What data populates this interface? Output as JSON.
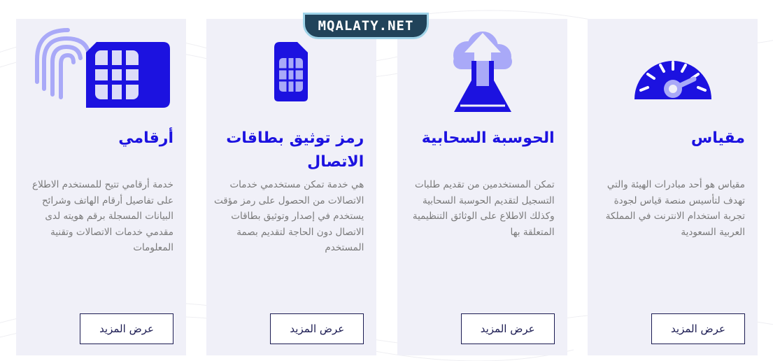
{
  "site": {
    "logo_text": "MQALATY.NET"
  },
  "cards": [
    {
      "title": "مقياس",
      "description": "مقياس هو أحد مبادرات الهيئة والتي تهدف لتأسيس منصة قياس لجودة تجربة استخدام الانترنت في المملكة العربية السعودية",
      "button_label": "عرض المزيد",
      "icon": "speedometer-icon"
    },
    {
      "title": "الحوسبة السحابية",
      "description": "تمكن المستخدمين من تقديم طلبات التسجيل لتقديم الحوسبة السحابية وكذلك الاطلاع على الوثائق التنظيمية المتعلقة بها",
      "button_label": "عرض المزيد",
      "icon": "cloud-upload-icon"
    },
    {
      "title": "رمز توثيق بطاقات الاتصال",
      "description": "هي خدمة تمكن مستخدمي خدمات الاتصالات من الحصول على رمز مؤقت يستخدم في إصدار وتوثيق بطاقات الاتصال دون الحاجة لتقديم بصمة المستخدم",
      "button_label": "عرض المزيد",
      "icon": "sim-card-icon"
    },
    {
      "title": "أرقامي",
      "description": "خدمة أرقامي تتيح للمستخدم الاطلاع على تفاصيل أرقام الهاتف وشرائح البيانات المسجلة برقم هويته لدى مقدمي خدمات الاتصالات وتقنية المعلومات",
      "button_label": "عرض المزيد",
      "icon": "fingerprint-sim-icon"
    }
  ],
  "colors": {
    "primary": "#1c12e0",
    "light": "#a9a9f8",
    "card_bg": "#f0f0f8",
    "text": "#7a7a7a",
    "button_border": "#1b1b52"
  }
}
